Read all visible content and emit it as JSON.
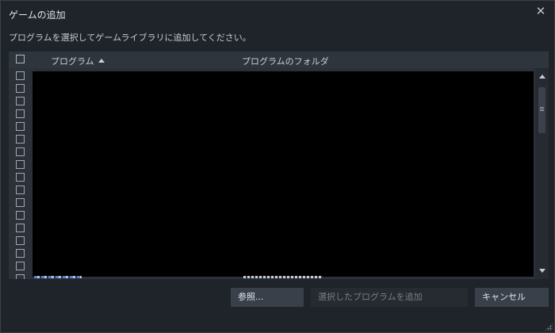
{
  "window": {
    "title": "ゲームの追加",
    "close_glyph": "✕"
  },
  "instructions": "プログラムを選択してゲームライブラリに追加してください。",
  "list": {
    "columns": {
      "program": "プログラム",
      "folder": "プログラムのフォルダ"
    },
    "sort": "program-ascending",
    "visible_checkbox_rows": 17,
    "rows_checked": false
  },
  "buttons": {
    "browse": "参照...",
    "add_selected": "選択したプログラムを追加",
    "cancel": "キャンセル"
  },
  "colors": {
    "background": "#1f242b",
    "panel": "#2c3139",
    "content": "#000000",
    "button": "#3a4049"
  }
}
